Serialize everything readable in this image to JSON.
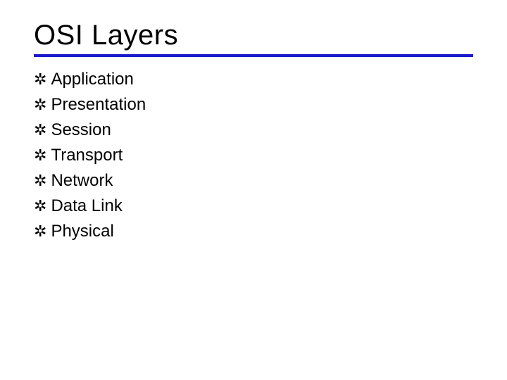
{
  "title": "OSI Layers",
  "bullet_glyph": "✲",
  "items": [
    "Application",
    "Presentation",
    "Session",
    "Transport",
    "Network",
    "Data Link",
    "Physical"
  ]
}
